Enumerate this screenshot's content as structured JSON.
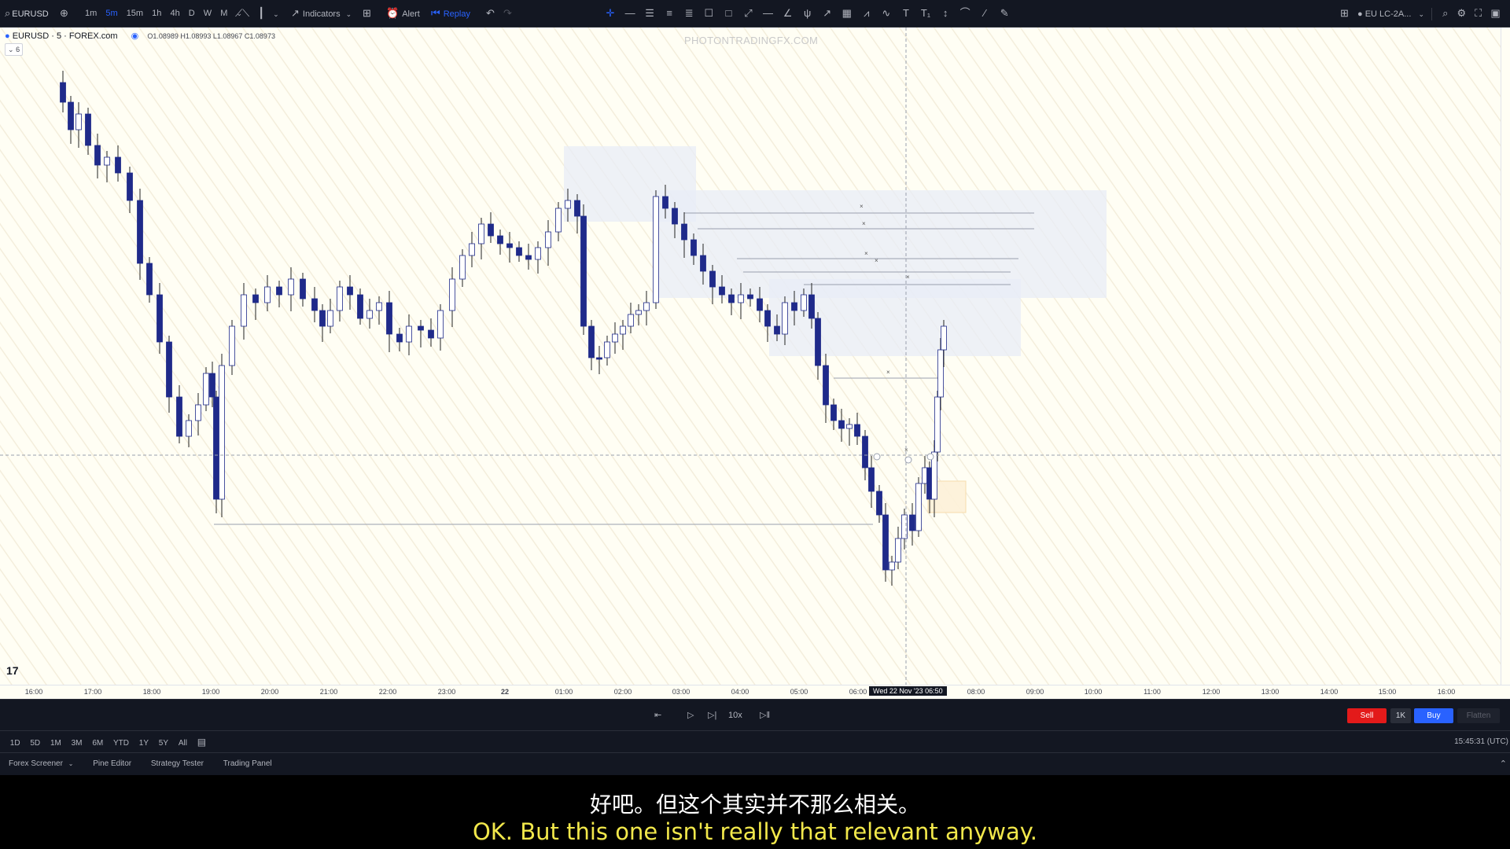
{
  "toolbar": {
    "symbol": "EURUSD",
    "timeframes": [
      "1m",
      "5m",
      "15m",
      "1h",
      "4h",
      "D",
      "W",
      "M"
    ],
    "active_timeframe": "5m",
    "indicators_label": "Indicators",
    "alert_label": "Alert",
    "replay_label": "Replay",
    "layout_name": "EU LC-2A..."
  },
  "legend": {
    "title": "EURUSD · 5 · FOREX.com",
    "ohlc": "O1.08989 H1.08993 L1.08967 C1.08973",
    "collapse_label": "6"
  },
  "watermark": "PHOTONTRADINGFX.COM",
  "logo_text": "17",
  "time_axis": {
    "labels": [
      "16:00",
      "17:00",
      "18:00",
      "19:00",
      "20:00",
      "21:00",
      "22:00",
      "23:00",
      "22",
      "01:00",
      "02:00",
      "03:00",
      "04:00",
      "05:00",
      "06:00",
      "08:00",
      "09:00",
      "10:00",
      "11:00",
      "12:00",
      "13:00",
      "14:00",
      "15:00",
      "16:00"
    ],
    "crosshair_label": "Wed 22 Nov '23   06:50"
  },
  "replay": {
    "speed": "10x",
    "sell_label": "Sell",
    "quantity": "1K",
    "buy_label": "Buy",
    "flatten_label": "Flatten"
  },
  "ranges": [
    "1D",
    "5D",
    "1M",
    "3M",
    "6M",
    "YTD",
    "1Y",
    "5Y",
    "All"
  ],
  "clock": "15:45:31 (UTC)",
  "panel_tabs": [
    "Forex Screener",
    "Pine Editor",
    "Strategy Tester",
    "Trading Panel"
  ],
  "subtitles": {
    "chinese": "好吧。但这个其实并不那么相关。",
    "english": "OK. But this one isn't really that relevant anyway."
  },
  "colors": {
    "bull": "#ffffff",
    "bear": "#1f2a8a",
    "chart_bg": "#fffef4",
    "accent": "#2962ff",
    "sell": "#e31a1a"
  }
}
